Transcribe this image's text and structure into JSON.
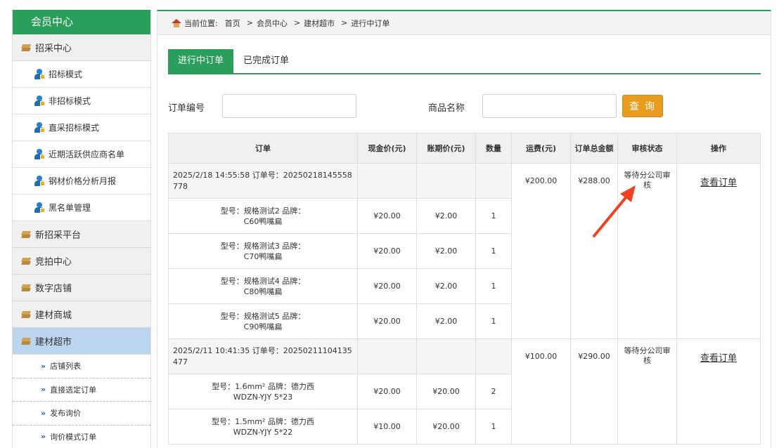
{
  "sidebar": {
    "title": "会员中心",
    "cat_procure": "招采中心",
    "sub_items": [
      "招标模式",
      "非招标模式",
      "直采招标模式",
      "近期活跃供应商名单",
      "钢材价格分析月报",
      "黑名单管理"
    ],
    "cats": [
      "新招采平台",
      "竞拍中心",
      "数字店铺",
      "建材商城"
    ],
    "cat_active": "建材超市",
    "sub2_items": [
      "店铺列表",
      "直接选定订单",
      "发布询价",
      "询价模式订单"
    ]
  },
  "breadcrumb": {
    "label": "当前位置:",
    "home": "首页",
    "sep": ">",
    "member": "会员中心",
    "market": "建材超市",
    "current": "进行中订单"
  },
  "tabs": {
    "active": "进行中订单",
    "done": "已完成订单"
  },
  "search": {
    "order_label": "订单编号",
    "order_value": "",
    "product_label": "商品名称",
    "product_value": "",
    "button": "查 询"
  },
  "table": {
    "headers": [
      "订单",
      "现金价(元)",
      "账期价(元)",
      "数量",
      "运费(元)",
      "订单总金额",
      "审核状态",
      "操作"
    ],
    "orders": [
      {
        "info": "2025/2/18 14:55:58    订单号：20250218145558778",
        "freight": "¥200.00",
        "total": "¥288.00",
        "status": "等待分公司审核",
        "action": "查看订单",
        "items": [
          {
            "spec_line1": "型号：规格测试2   品牌：",
            "spec_line2": "C60鸭嘴扁",
            "cash": "¥20.00",
            "credit": "¥2.00",
            "qty": "1"
          },
          {
            "spec_line1": "型号：规格测试3   品牌：",
            "spec_line2": "C70鸭嘴扁",
            "cash": "¥20.00",
            "credit": "¥2.00",
            "qty": "1"
          },
          {
            "spec_line1": "型号：规格测试4   品牌：",
            "spec_line2": "C80鸭嘴扁",
            "cash": "¥20.00",
            "credit": "¥2.00",
            "qty": "1"
          },
          {
            "spec_line1": "型号：规格测试5   品牌：",
            "spec_line2": "C90鸭嘴扁",
            "cash": "¥20.00",
            "credit": "¥2.00",
            "qty": "1"
          }
        ]
      },
      {
        "info": "2025/2/11 10:41:35    订单号：20250211104135477",
        "freight": "¥100.00",
        "total": "¥290.00",
        "status": "等待分公司审核",
        "action": "查看订单",
        "items": [
          {
            "spec_line1": "型号：1.6mm²   品牌：德力西",
            "spec_line2": "WDZN-YJY 5*23",
            "cash": "¥20.00",
            "credit": "¥20.00",
            "qty": "2"
          },
          {
            "spec_line1": "型号：1.5mm²   品牌：德力西",
            "spec_line2": "WDZN-YJY 5*22",
            "cash": "¥10.00",
            "credit": "¥20.00",
            "qty": "1"
          }
        ]
      }
    ]
  },
  "annotation_color": "#ef4223"
}
